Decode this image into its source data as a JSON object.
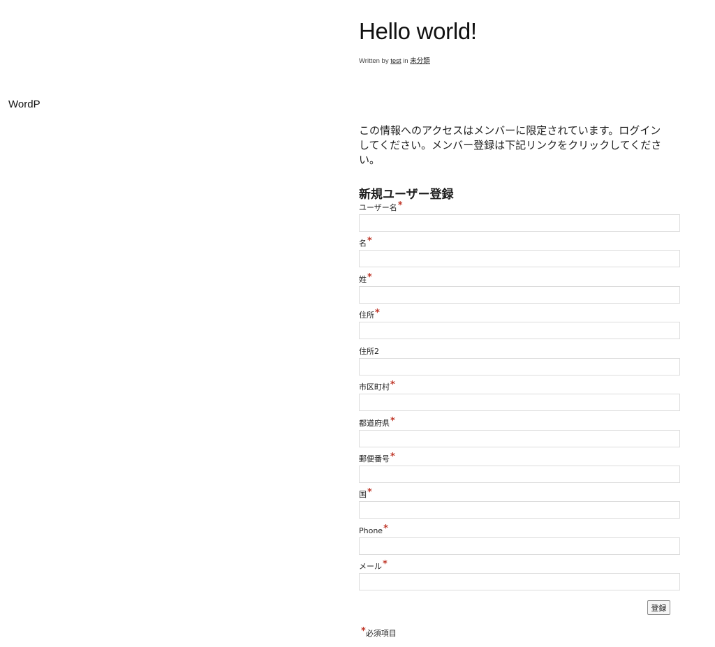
{
  "site": {
    "title": "WordP"
  },
  "post": {
    "title": "Hello world!",
    "meta": {
      "written_by": "Written by",
      "author": "test",
      "in": "in",
      "category": "未分類"
    },
    "notice": "この情報へのアクセスはメンバーに限定されています。ログインしてください。メンバー登録は下記リンクをクリックしてください。"
  },
  "form": {
    "heading": "新規ユーザー登録",
    "required_mark": "*",
    "fields": [
      {
        "label": "ユーザー名",
        "required": true,
        "value": ""
      },
      {
        "label": "名",
        "required": true,
        "value": ""
      },
      {
        "label": "姓",
        "required": true,
        "value": ""
      },
      {
        "label": "住所",
        "required": true,
        "value": ""
      },
      {
        "label": "住所2",
        "required": false,
        "value": ""
      },
      {
        "label": "市区町村",
        "required": true,
        "value": ""
      },
      {
        "label": "都道府県",
        "required": true,
        "value": ""
      },
      {
        "label": "郵便番号",
        "required": true,
        "value": ""
      },
      {
        "label": "国",
        "required": true,
        "value": ""
      },
      {
        "label": "Phone",
        "required": true,
        "value": ""
      },
      {
        "label": "メール",
        "required": true,
        "value": ""
      }
    ],
    "submit_label": "登録",
    "required_note": "必須項目"
  },
  "colors": {
    "required_asterisk": "#c0392b",
    "input_border": "#dcdcdc"
  }
}
